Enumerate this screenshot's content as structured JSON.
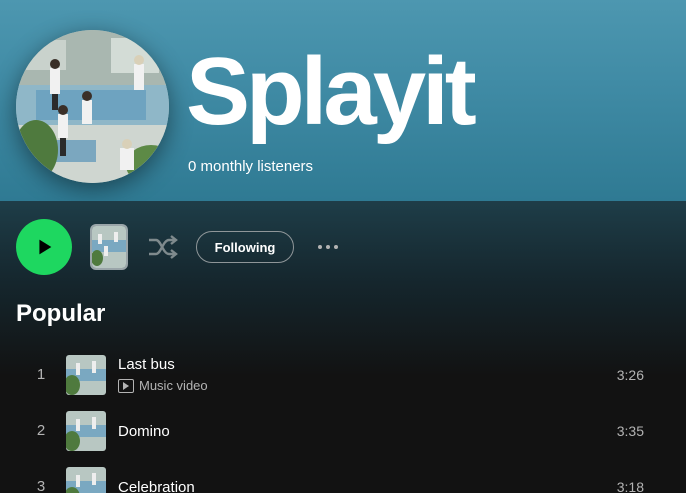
{
  "artist": {
    "name": "Splayit",
    "listeners": "0 monthly listeners"
  },
  "controls": {
    "play_icon": "play-icon",
    "shuffle_icon": "shuffle-icon",
    "following_label": "Following",
    "more_icon": "more-options-icon"
  },
  "popular": {
    "title": "Popular",
    "tracks": [
      {
        "num": "1",
        "title": "Last bus",
        "sub": "Music video",
        "duration": "3:26"
      },
      {
        "num": "2",
        "title": "Domino",
        "duration": "3:35"
      },
      {
        "num": "3",
        "title": "Celebration",
        "duration": "3:18"
      }
    ]
  },
  "colors": {
    "accent": "#1ed760",
    "header_top": "#4d97b0",
    "background": "#121212"
  }
}
